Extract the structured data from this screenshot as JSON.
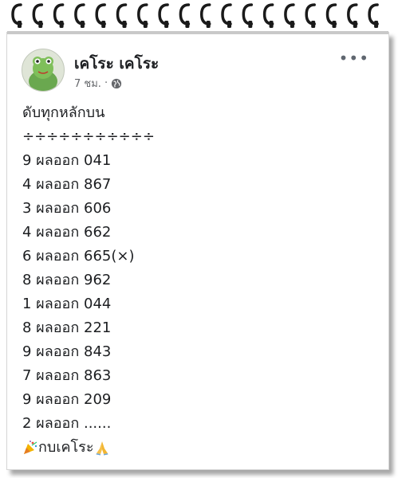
{
  "post": {
    "author": "เคโระ เคโระ",
    "time": "7 ชม.",
    "separator_dot": "·",
    "more": "•••",
    "lines": [
      "ดับทุกหลักบน",
      "÷÷÷÷÷÷÷÷÷÷÷",
      "9 ผลออก 041",
      "4 ผลออก 867",
      "3 ผลออก 606",
      "4 ผลออก 662",
      "6 ผลออก 665(×)",
      "8 ผลออก 962",
      "1 ผลออก 044",
      "8 ผลออก 221",
      "9 ผลออก 843",
      "7 ผลออก 863",
      "9 ผลออก 209",
      "2 ผลออก ......"
    ],
    "signoff": "กบเคโระ",
    "icons": {
      "avatar": "frog-avatar",
      "privacy": "globe-icon",
      "signoff_start": "party-popper-icon",
      "signoff_end": "praying-hands-icon"
    }
  },
  "colors": {
    "text": "#1c1e21",
    "meta": "#65676b"
  }
}
